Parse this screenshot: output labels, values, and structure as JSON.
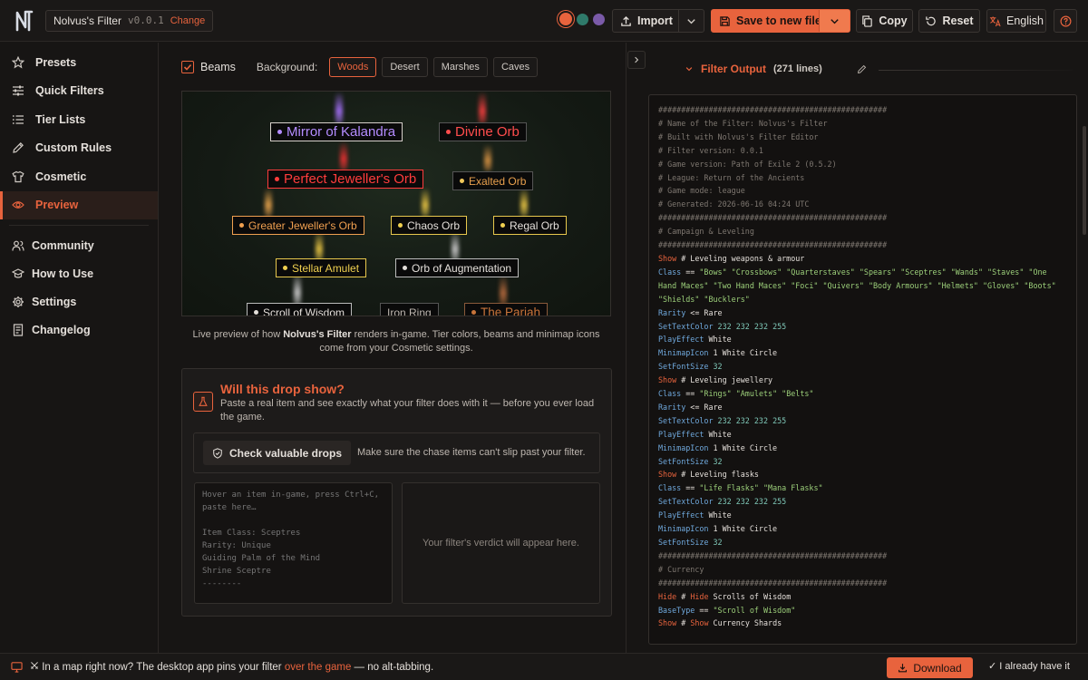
{
  "header": {
    "filter_name": "Nolvus's Filter",
    "version": "v0.0.1",
    "change_label": "Change",
    "import_label": "Import",
    "save_label": "Save to new file",
    "copy_label": "Copy",
    "reset_label": "Reset",
    "language_label": "English",
    "theme_colors": [
      "#e8633d",
      "#2f7a6a",
      "#7a5aa8"
    ]
  },
  "sidebar": {
    "items": [
      {
        "label": "Presets",
        "icon": "star-icon"
      },
      {
        "label": "Quick Filters",
        "icon": "sliders-icon"
      },
      {
        "label": "Tier Lists",
        "icon": "list-icon"
      },
      {
        "label": "Custom Rules",
        "icon": "pencil-icon"
      },
      {
        "label": "Cosmetic",
        "icon": "shirt-icon"
      },
      {
        "label": "Preview",
        "icon": "eye-icon",
        "active": true
      }
    ],
    "secondary": [
      {
        "label": "Community",
        "icon": "users-icon"
      },
      {
        "label": "How to Use",
        "icon": "graduation-cap-icon"
      },
      {
        "label": "Settings",
        "icon": "gear-icon"
      },
      {
        "label": "Changelog",
        "icon": "document-icon"
      }
    ]
  },
  "preview": {
    "beams_label": "Beams",
    "beams_checked": true,
    "background_label": "Background:",
    "backgrounds": [
      "Woods",
      "Desert",
      "Marshes",
      "Caves"
    ],
    "active_background": "Woods",
    "items": [
      {
        "name": "Mirror of Kalandra",
        "color": "#b48cff",
        "border": "#d6d0ca",
        "bullet": "#b48cff"
      },
      {
        "name": "Divine Orb",
        "color": "#ff4d4d",
        "border": "#555",
        "bullet": "#ff4d4d"
      },
      {
        "name": "Perfect Jeweller's Orb",
        "color": "#ff3c3c",
        "border": "#ff3c3c",
        "bullet": "#ff3c3c"
      },
      {
        "name": "Exalted Orb",
        "color": "#e8a04d",
        "border": "#555",
        "bullet": "#f0c75a"
      },
      {
        "name": "Greater Jeweller's Orb",
        "color": "#f0a050",
        "border": "#f0a050",
        "bullet": "#f0a050"
      },
      {
        "name": "Chaos Orb",
        "color": "#e4dfda",
        "border": "#e8c84d",
        "bullet": "#f0d050"
      },
      {
        "name": "Regal Orb",
        "color": "#e4dfda",
        "border": "#e8c84d",
        "bullet": "#f0d050"
      },
      {
        "name": "Stellar Amulet",
        "color": "#f0d050",
        "border": "#e8c84d",
        "bullet": "#f0d050"
      },
      {
        "name": "Orb of Augmentation",
        "color": "#e4dfda",
        "border": "#bbb",
        "bullet": "#e4dfda"
      },
      {
        "name": "Scroll of Wisdom",
        "color": "#e4dfda",
        "border": "#bbb",
        "bullet": "#e4dfda"
      },
      {
        "name": "Iron Ring",
        "color": "#bdb6af",
        "border": "#555",
        "bullet": null
      },
      {
        "name": "The Pariah",
        "color": "#c8743a",
        "border": "#8a5a3a",
        "bullet": "#c8743a"
      }
    ],
    "caption_pre": "Live preview of how ",
    "caption_bold": "Nolvus's Filter",
    "caption_post": " renders in-game. Tier colors, beams and minimap icons come from your Cosmetic settings."
  },
  "drop_check": {
    "title": "Will this drop show?",
    "description": "Paste a real item and see exactly what your filter does with it — before you ever load the game.",
    "check_button": "Check valuable drops",
    "check_hint": "Make sure the chase items can't slip past your filter.",
    "paste_placeholder": "Hover an item in-game, press Ctrl+C, paste here…\n\nItem Class: Sceptres\nRarity: Unique\nGuiding Palm of the Mind\nShrine Sceptre\n--------",
    "verdict_placeholder": "Your filter's verdict will appear here."
  },
  "output": {
    "title": "Filter Output",
    "line_count": "(271 lines)",
    "lines": [
      [
        [
          "c",
          "##################################################"
        ]
      ],
      [
        [
          "c",
          "# Name of the Filter: Nolvus's Filter"
        ]
      ],
      [
        [
          "c",
          "# Built with Nolvus's Filter Editor"
        ]
      ],
      [
        [
          "c",
          "# Filter version: 0.0.1"
        ]
      ],
      [
        [
          "c",
          "# Game version: Path of Exile 2 (0.5.2)"
        ]
      ],
      [
        [
          "c",
          "# League: Return of the Ancients"
        ]
      ],
      [
        [
          "c",
          "# Game mode: league"
        ]
      ],
      [
        [
          "c",
          "# Generated: 2026-06-16 04:24 UTC"
        ]
      ],
      [
        [
          "c",
          "##################################################"
        ]
      ],
      [
        [
          "c",
          "# Campaign & Leveling"
        ]
      ],
      [
        [
          "c",
          "##################################################"
        ]
      ],
      [
        [
          "k",
          "Show"
        ],
        [
          "v",
          " # Leveling weapons & armour"
        ]
      ],
      [
        [
          "p",
          "Class"
        ],
        [
          "v",
          " == "
        ],
        [
          "s",
          "\"Bows\" \"Crossbows\" \"Quarterstaves\" \"Spears\" \"Sceptres\" \"Wands\" \"Staves\" \"One Hand Maces\" \"Two Hand Maces\" \"Foci\" \"Quivers\" \"Body Armours\" \"Helmets\" \"Gloves\" \"Boots\" \"Shields\" \"Bucklers\""
        ]
      ],
      [
        [
          "p",
          "Rarity"
        ],
        [
          "v",
          " <= Rare"
        ]
      ],
      [
        [
          "p",
          "SetTextColor"
        ],
        [
          "n",
          " 232 232 232 255"
        ]
      ],
      [
        [
          "p",
          "PlayEffect"
        ],
        [
          "v",
          " White"
        ]
      ],
      [
        [
          "p",
          "MinimapIcon"
        ],
        [
          "v",
          " 1 White Circle"
        ]
      ],
      [
        [
          "p",
          "SetFontSize"
        ],
        [
          "n",
          " 32"
        ]
      ],
      [
        [
          "k",
          "Show"
        ],
        [
          "v",
          " # Leveling jewellery"
        ]
      ],
      [
        [
          "p",
          "Class"
        ],
        [
          "v",
          " == "
        ],
        [
          "s",
          "\"Rings\" \"Amulets\" \"Belts\""
        ]
      ],
      [
        [
          "p",
          "Rarity"
        ],
        [
          "v",
          " <= Rare"
        ]
      ],
      [
        [
          "p",
          "SetTextColor"
        ],
        [
          "n",
          " 232 232 232 255"
        ]
      ],
      [
        [
          "p",
          "PlayEffect"
        ],
        [
          "v",
          " White"
        ]
      ],
      [
        [
          "p",
          "MinimapIcon"
        ],
        [
          "v",
          " 1 White Circle"
        ]
      ],
      [
        [
          "p",
          "SetFontSize"
        ],
        [
          "n",
          " 32"
        ]
      ],
      [
        [
          "k",
          "Show"
        ],
        [
          "v",
          " # Leveling flasks"
        ]
      ],
      [
        [
          "p",
          "Class"
        ],
        [
          "v",
          " == "
        ],
        [
          "s",
          "\"Life Flasks\" \"Mana Flasks\""
        ]
      ],
      [
        [
          "p",
          "SetTextColor"
        ],
        [
          "n",
          " 232 232 232 255"
        ]
      ],
      [
        [
          "p",
          "PlayEffect"
        ],
        [
          "v",
          " White"
        ]
      ],
      [
        [
          "p",
          "MinimapIcon"
        ],
        [
          "v",
          " 1 White Circle"
        ]
      ],
      [
        [
          "p",
          "SetFontSize"
        ],
        [
          "n",
          " 32"
        ]
      ],
      [
        [
          "c",
          "##################################################"
        ]
      ],
      [
        [
          "c",
          "# Currency"
        ]
      ],
      [
        [
          "c",
          "##################################################"
        ]
      ],
      [
        [
          "k",
          "Hide"
        ],
        [
          "v",
          " # "
        ],
        [
          "k",
          "Hide"
        ],
        [
          "v",
          " Scrolls of Wisdom"
        ]
      ],
      [
        [
          "p",
          "BaseType"
        ],
        [
          "v",
          " == "
        ],
        [
          "s",
          "\"Scroll of Wisdom\""
        ]
      ],
      [
        [
          "k",
          "Show"
        ],
        [
          "v",
          " # "
        ],
        [
          "k",
          "Show"
        ],
        [
          "v",
          " Currency Shards"
        ]
      ]
    ]
  },
  "footer": {
    "text_pre": "In a map right now? The desktop app pins your filter ",
    "text_accent": "over the game",
    "text_post": " — no alt-tabbing.",
    "download_label": "Download",
    "have_label": "✓ I already have it"
  }
}
